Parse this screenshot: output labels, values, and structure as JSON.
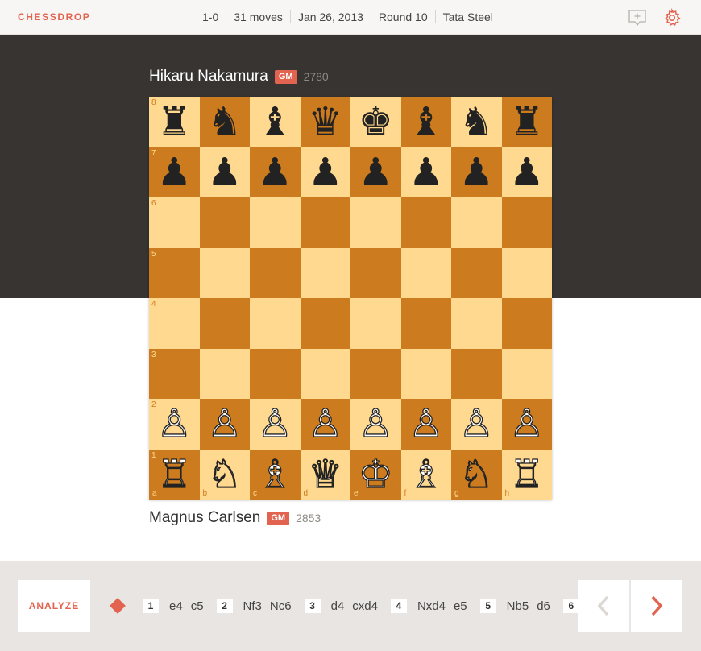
{
  "brand": "CHESSDROP",
  "game": {
    "result": "1-0",
    "moves_count": "31 moves",
    "date": "Jan 26, 2013",
    "round": "Round 10",
    "event": "Tata Steel"
  },
  "icons": {
    "comment": "add-comment-icon",
    "settings": "gear-icon",
    "prev": "chevron-left-icon",
    "next": "chevron-right-icon"
  },
  "colors": {
    "accent": "#e2634f",
    "light_square": "#ffd98f",
    "dark_square": "#cc7b1f",
    "band": "#373432"
  },
  "players": {
    "top": {
      "name": "Hikaru Nakamura",
      "title": "GM",
      "rating": "2780"
    },
    "bottom": {
      "name": "Magnus Carlsen",
      "title": "GM",
      "rating": "2853"
    }
  },
  "board": {
    "ranks": [
      "8",
      "7",
      "6",
      "5",
      "4",
      "3",
      "2",
      "1"
    ],
    "files": [
      "a",
      "b",
      "c",
      "d",
      "e",
      "f",
      "g",
      "h"
    ],
    "rows": [
      [
        "♜",
        "♞",
        "♝",
        "♛",
        "♚",
        "♝",
        "♞",
        "♜"
      ],
      [
        "♟",
        "♟",
        "♟",
        "♟",
        "♟",
        "♟",
        "♟",
        "♟"
      ],
      [
        "",
        "",
        "",
        "",
        "",
        "",
        "",
        ""
      ],
      [
        "",
        "",
        "",
        "",
        "",
        "",
        "",
        ""
      ],
      [
        "",
        "",
        "",
        "",
        "",
        "",
        "",
        ""
      ],
      [
        "",
        "",
        "",
        "",
        "",
        "",
        "",
        ""
      ],
      [
        "♙",
        "♙",
        "♙",
        "♙",
        "♙",
        "♙",
        "♙",
        "♙"
      ],
      [
        "♖",
        "♘",
        "♗",
        "♕",
        "♔",
        "♗",
        "♘",
        "♖"
      ]
    ]
  },
  "footer": {
    "analyze_label": "ANALYZE",
    "moves": [
      {
        "num": "1",
        "white": "e4",
        "black": "c5"
      },
      {
        "num": "2",
        "white": "Nf3",
        "black": "Nc6"
      },
      {
        "num": "3",
        "white": "d4",
        "black": "cxd4"
      },
      {
        "num": "4",
        "white": "Nxd4",
        "black": "e5"
      },
      {
        "num": "5",
        "white": "Nb5",
        "black": "d6"
      },
      {
        "num": "6",
        "white": "",
        "black": ""
      }
    ]
  }
}
